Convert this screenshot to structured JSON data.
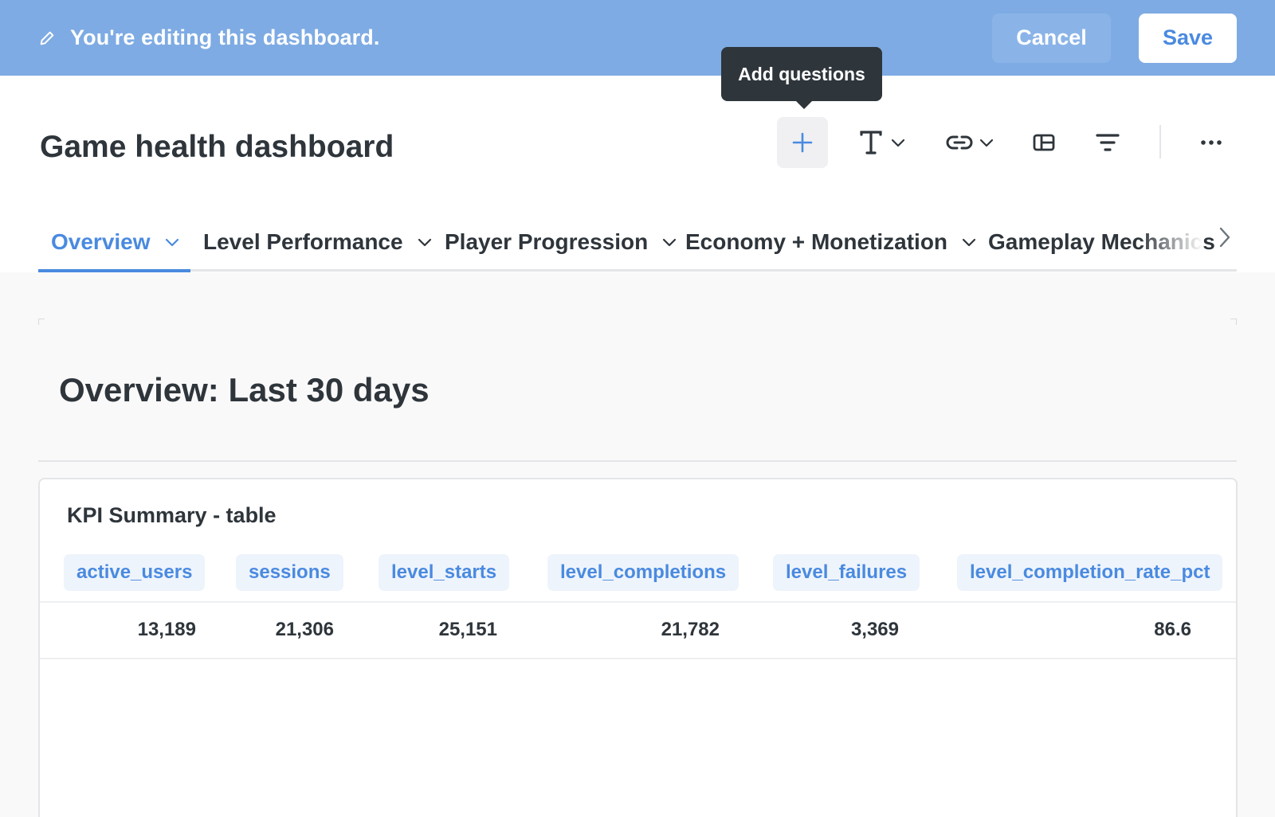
{
  "edit_banner": {
    "message": "You're editing this dashboard.",
    "cancel_label": "Cancel",
    "save_label": "Save"
  },
  "header": {
    "title": "Game health dashboard",
    "tooltip": "Add questions",
    "toolbar": [
      {
        "name": "add-questions",
        "icon": "plus-icon"
      },
      {
        "name": "add-text",
        "icon": "text-icon"
      },
      {
        "name": "add-link",
        "icon": "link-icon"
      },
      {
        "name": "add-section",
        "icon": "section-icon"
      },
      {
        "name": "add-filter",
        "icon": "filter-icon"
      },
      {
        "name": "more",
        "icon": "ellipsis-icon"
      }
    ]
  },
  "tabs": [
    {
      "label": "Overview",
      "active": true
    },
    {
      "label": "Level Performance",
      "active": false
    },
    {
      "label": "Player Progression",
      "active": false
    },
    {
      "label": "Economy + Monetization",
      "active": false
    },
    {
      "label": "Gameplay Mechanics",
      "active": false
    }
  ],
  "content": {
    "heading": "Overview: Last 30 days",
    "card": {
      "title": "KPI Summary - table",
      "columns": [
        "active_users",
        "sessions",
        "level_starts",
        "level_completions",
        "level_failures",
        "level_completion_rate_pct"
      ],
      "rows": [
        [
          "13,189",
          "21,306",
          "25,151",
          "21,782",
          "3,369",
          "86.6"
        ]
      ]
    }
  },
  "colors": {
    "banner": "#7eabe3",
    "accent": "#4a8ae0",
    "text": "#2e353b",
    "tooltip_bg": "#2e353b"
  }
}
